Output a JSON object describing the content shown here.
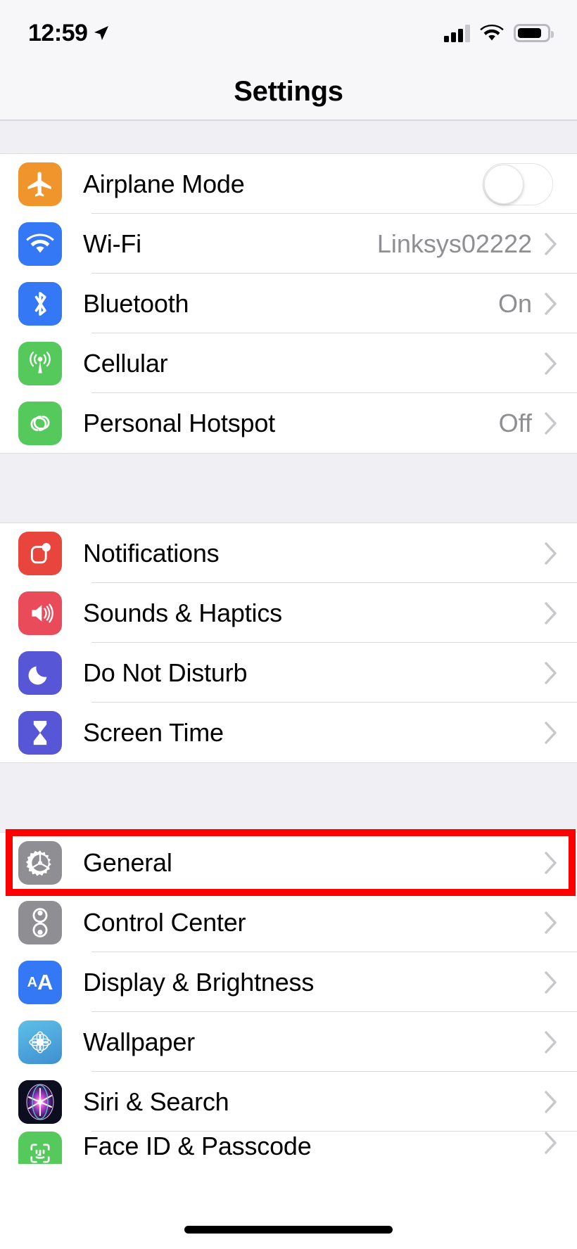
{
  "status_bar": {
    "time": "12:59",
    "location_icon": "location-arrow-icon",
    "signal_icon": "cellular-signal-icon",
    "signal_bars_filled": 3,
    "signal_bars_total": 4,
    "wifi_icon": "wifi-icon",
    "battery_icon": "battery-icon",
    "battery_percent": 78
  },
  "nav": {
    "title": "Settings"
  },
  "colors": {
    "airplane": "#f0952b",
    "wifi": "#3478f6",
    "bluetooth": "#3478f6",
    "cellular": "#55c95b",
    "hotspot": "#55c95b",
    "notifications": "#e8453c",
    "sounds": "#e94b5b",
    "dnd": "#5756d6",
    "screentime": "#5756d6",
    "general": "#8e8e93",
    "control_center": "#8e8e93",
    "display": "#3478f6",
    "wallpaper": "#4aa3dd",
    "siri": "#22223a",
    "faceid": "#55c95b",
    "highlight": "#fe0000",
    "value_text": "#8e8e93",
    "chevron": "#c7c7cc",
    "group_bg": "#efeff4",
    "row_bg": "#ffffff",
    "separator": "#d9d9de"
  },
  "groups": [
    {
      "id": "connectivity",
      "rows": [
        {
          "label": "Airplane Mode",
          "icon": "airplane-icon",
          "icon_color": "#f0952b",
          "accessory": "toggle",
          "toggle_on": false
        },
        {
          "label": "Wi-Fi",
          "icon": "wifi-icon",
          "icon_color": "#3478f6",
          "accessory": "chevron",
          "value": "Linksys02222"
        },
        {
          "label": "Bluetooth",
          "icon": "bluetooth-icon",
          "icon_color": "#3478f6",
          "accessory": "chevron",
          "value": "On"
        },
        {
          "label": "Cellular",
          "icon": "cellular-icon",
          "icon_color": "#55c95b",
          "accessory": "chevron",
          "value": ""
        },
        {
          "label": "Personal Hotspot",
          "icon": "personal-hotspot-icon",
          "icon_color": "#55c95b",
          "accessory": "chevron",
          "value": "Off"
        }
      ]
    },
    {
      "id": "alerts",
      "rows": [
        {
          "label": "Notifications",
          "icon": "notifications-icon",
          "icon_color": "#e8453c",
          "accessory": "chevron",
          "value": ""
        },
        {
          "label": "Sounds & Haptics",
          "icon": "sounds-haptics-icon",
          "icon_color": "#e94b5b",
          "accessory": "chevron",
          "value": ""
        },
        {
          "label": "Do Not Disturb",
          "icon": "do-not-disturb-icon",
          "icon_color": "#5756d6",
          "accessory": "chevron",
          "value": ""
        },
        {
          "label": "Screen Time",
          "icon": "screen-time-icon",
          "icon_color": "#5756d6",
          "accessory": "chevron",
          "value": ""
        }
      ]
    },
    {
      "id": "system",
      "rows": [
        {
          "label": "General",
          "icon": "gear-icon",
          "icon_color": "#8e8e93",
          "accessory": "chevron",
          "value": "",
          "highlighted": true
        },
        {
          "label": "Control Center",
          "icon": "control-center-icon",
          "icon_color": "#8e8e93",
          "accessory": "chevron",
          "value": ""
        },
        {
          "label": "Display & Brightness",
          "icon": "display-brightness-icon",
          "icon_color": "#3478f6",
          "accessory": "chevron",
          "value": ""
        },
        {
          "label": "Wallpaper",
          "icon": "wallpaper-icon",
          "icon_color": "#4aa3dd",
          "accessory": "chevron",
          "value": ""
        },
        {
          "label": "Siri & Search",
          "icon": "siri-search-icon",
          "icon_color": "#22223a",
          "accessory": "chevron",
          "value": ""
        },
        {
          "label": "Face ID & Passcode",
          "icon": "face-id-icon",
          "icon_color": "#55c95b",
          "accessory": "chevron",
          "value": ""
        }
      ]
    }
  ],
  "home_indicator": "home-indicator"
}
